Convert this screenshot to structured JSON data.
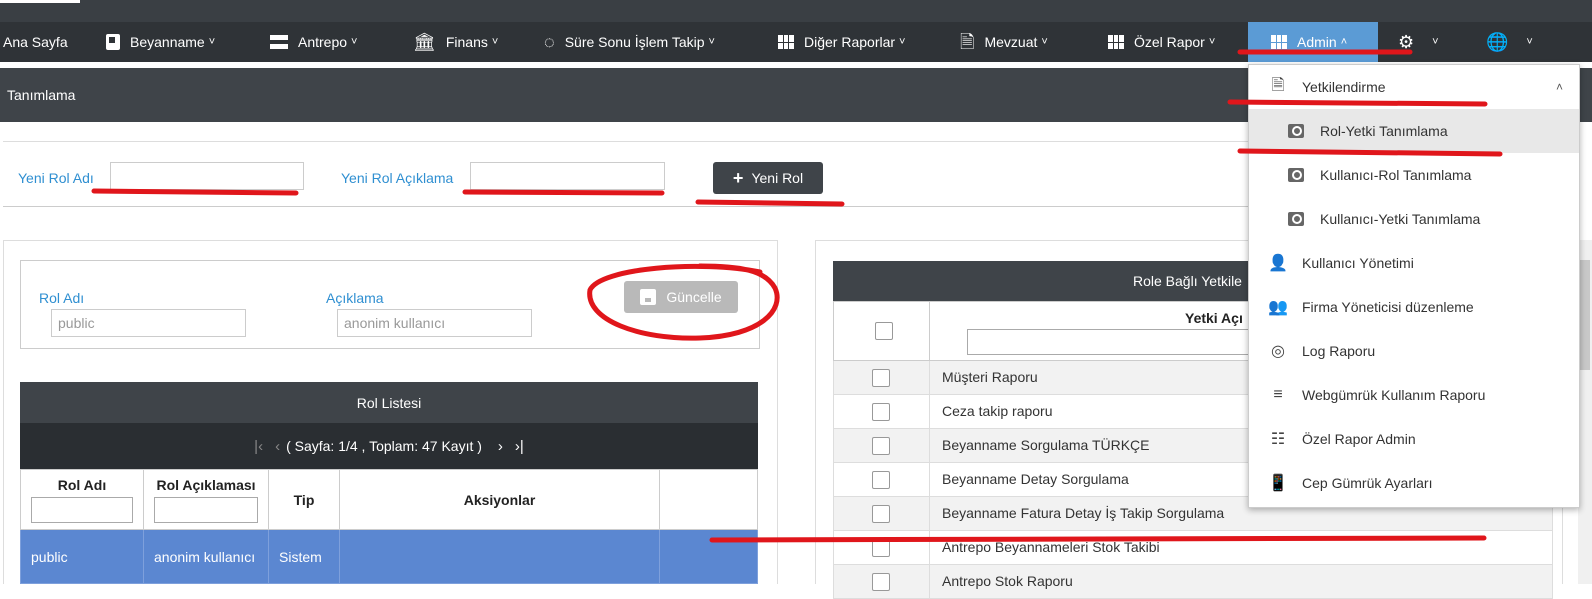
{
  "nav": {
    "home": "Ana Sayfa",
    "items": [
      {
        "label": "Beyanname"
      },
      {
        "label": "Antrepo"
      },
      {
        "label": "Finans"
      },
      {
        "label": "Süre Sonu İşlem Takip"
      },
      {
        "label": "Diğer Raporlar"
      },
      {
        "label": "Mevzuat"
      },
      {
        "label": "Özel Rapor"
      },
      {
        "label": "Admin"
      }
    ]
  },
  "subheader": {
    "title": "Tanımlama"
  },
  "new_role": {
    "name_label": "Yeni Rol Adı",
    "name_value": "",
    "desc_label": "Yeni Rol Açıklama",
    "desc_value": "",
    "button_label": "Yeni Rol"
  },
  "edit_role": {
    "name_label": "Rol Adı",
    "name_value": "public",
    "desc_label": "Açıklama",
    "desc_value": "anonim kullanıcı",
    "update_label": "Güncelle"
  },
  "role_list": {
    "title": "Rol Listesi",
    "pager_text": "( Sayfa: 1/4 , Toplam: 47 Kayıt )",
    "columns": [
      "Rol Adı",
      "Rol Açıklaması",
      "Tip",
      "Aksiyonlar"
    ],
    "rows": [
      {
        "name": "public",
        "desc": "anonim kullanıcı",
        "type": "Sistem",
        "actions": ""
      }
    ]
  },
  "permissions": {
    "title": "Role Bağlı Yetkile",
    "column": "Yetki Açı",
    "rows": [
      "Müşteri Raporu",
      "Ceza takip raporu",
      "Beyanname Sorgulama TÜRKÇE",
      "Beyanname Detay Sorgulama",
      "Beyanname Fatura Detay İş Takip Sorgulama",
      "Antrepo Beyannameleri Stok Takibi",
      "Antrepo Stok Raporu"
    ]
  },
  "admin_menu": {
    "group": "Yetkilendirme",
    "sub_items": [
      "Rol-Yetki Tanımlama",
      "Kullanıcı-Rol Tanımlama",
      "Kullanıcı-Yetki Tanımlama"
    ],
    "items": [
      {
        "label": "Kullanıcı Yönetimi",
        "icon": "user-card-icon"
      },
      {
        "label": "Firma Yöneticisi düzenleme",
        "icon": "users-icon"
      },
      {
        "label": "Log Raporu",
        "icon": "fingerprint-icon"
      },
      {
        "label": "Webgümrük Kullanım Raporu",
        "icon": "server-icon"
      },
      {
        "label": "Özel Rapor Admin",
        "icon": "dashed-grid-icon"
      },
      {
        "label": "Cep Gümrük Ayarları",
        "icon": "mobile-settings-icon"
      }
    ]
  },
  "annotation_color": "#e0161b"
}
